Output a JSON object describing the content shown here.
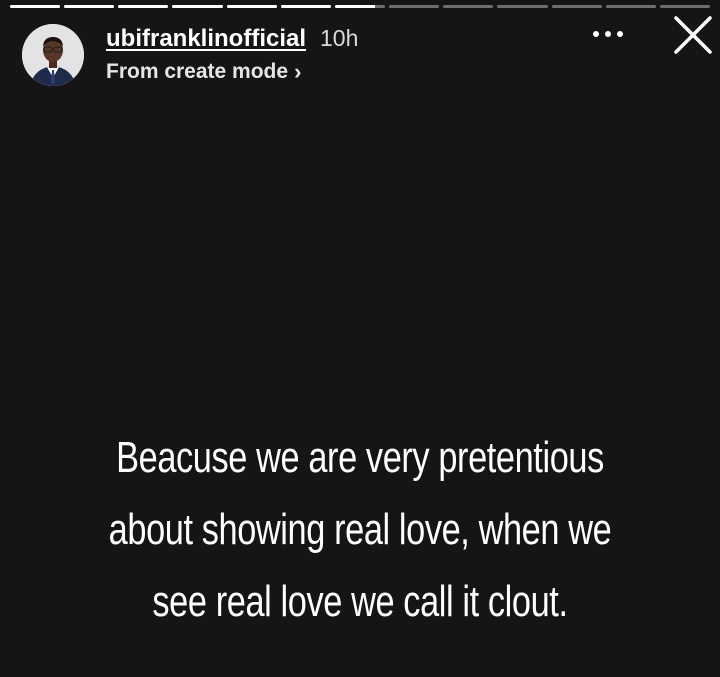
{
  "story": {
    "progress_segments": [
      {
        "fill": 1
      },
      {
        "fill": 1
      },
      {
        "fill": 1
      },
      {
        "fill": 1
      },
      {
        "fill": 1
      },
      {
        "fill": 1
      },
      {
        "fill": 0.8
      },
      {
        "fill": 0
      },
      {
        "fill": 0
      },
      {
        "fill": 0
      },
      {
        "fill": 0
      },
      {
        "fill": 0
      },
      {
        "fill": 0
      }
    ]
  },
  "header": {
    "username": "ubifranklinofficial",
    "time": "10h",
    "mode_label": "From create mode",
    "mode_chevron": "›"
  },
  "icons": {
    "avatar": "profile-avatar",
    "more": "ellipsis-icon",
    "close": "close-icon"
  },
  "caption": {
    "lines": [
      "Beacuse we are very pretentious",
      "about showing real love, when we",
      "see real love we call it clout."
    ]
  },
  "colors": {
    "background": "#151515",
    "text": "#ffffff",
    "secondary_text": "#d9d9d9"
  }
}
